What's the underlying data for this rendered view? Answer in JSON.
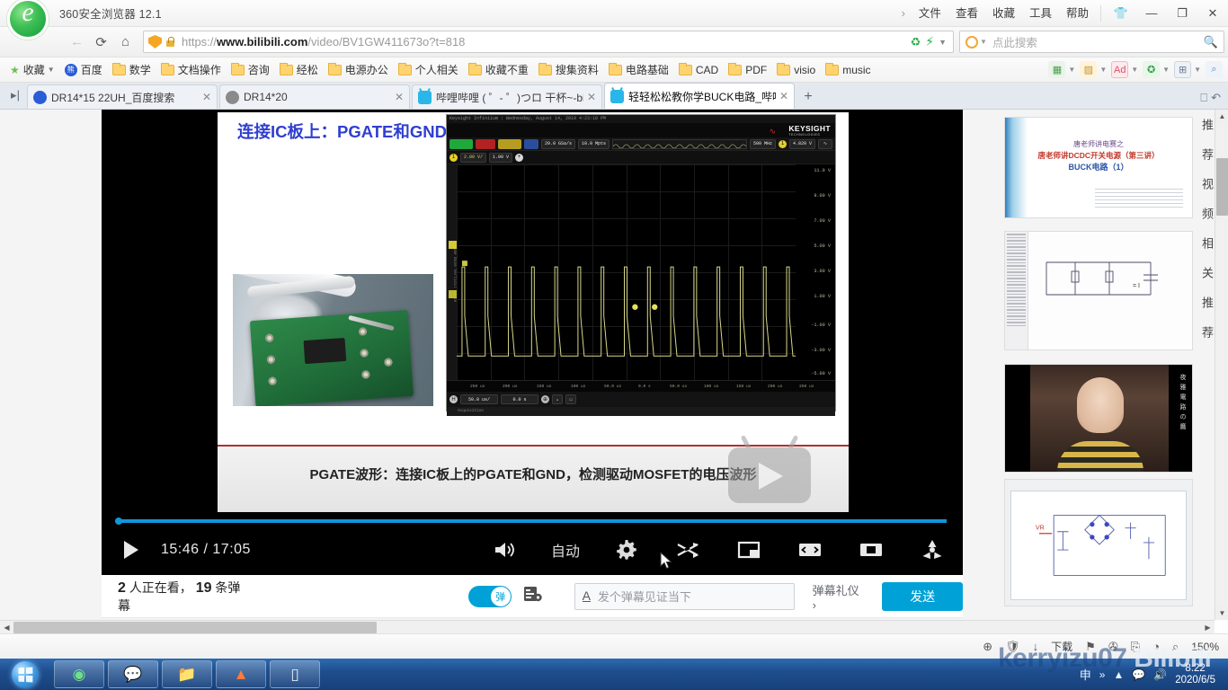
{
  "browser": {
    "app_name": "360安全浏览器 12.1",
    "menus": [
      "文件",
      "查看",
      "收藏",
      "工具",
      "帮助"
    ],
    "window_controls": {
      "minimize": "—",
      "maximize": "❐",
      "close": "✕",
      "skin": "👕",
      "chevron": "›"
    },
    "address": {
      "scheme": "https://",
      "domain": "www.bilibili.com",
      "path": "/video/BV1GW411673o?t=818",
      "full": "https://www.bilibili.com/video/BV1GW411673o?t=818"
    },
    "search": {
      "placeholder": "点此搜索"
    },
    "nav": {
      "back": "←",
      "reload": "⟳",
      "home": "⌂"
    },
    "bookmarks": [
      {
        "label": "收藏",
        "icon": "star-icon"
      },
      {
        "label": "百度",
        "icon": "baidu-icon"
      },
      {
        "label": "数学",
        "icon": "folder-icon"
      },
      {
        "label": "文档操作",
        "icon": "folder-icon"
      },
      {
        "label": "咨询",
        "icon": "folder-icon"
      },
      {
        "label": "经松",
        "icon": "folder-icon"
      },
      {
        "label": "电源办公",
        "icon": "folder-icon"
      },
      {
        "label": "个人相关",
        "icon": "folder-icon"
      },
      {
        "label": "收藏不重",
        "icon": "folder-icon"
      },
      {
        "label": "搜集资料",
        "icon": "folder-icon"
      },
      {
        "label": "电路基础",
        "icon": "folder-icon"
      },
      {
        "label": "CAD",
        "icon": "folder-icon"
      },
      {
        "label": "PDF",
        "icon": "folder-icon"
      },
      {
        "label": "visio",
        "icon": "folder-icon"
      },
      {
        "label": "music",
        "icon": "folder-icon"
      }
    ],
    "extensions": [
      "▦",
      "▨",
      "Ad",
      "✪",
      "⊞",
      "⌕"
    ],
    "tabs": [
      {
        "label": "DR14*15 22UH_百度搜索",
        "icon": "baidu-favicon",
        "active": false
      },
      {
        "label": "DR14*20",
        "icon": "globe-favicon",
        "active": false
      },
      {
        "label": "哔哩哔哩 ( ゜- ゜)つロ 干杯~-bi",
        "icon": "bilibili-favicon",
        "active": false
      },
      {
        "label": "轻轻松松教你学BUCK电路_哔哩",
        "icon": "bilibili-favicon",
        "active": true
      }
    ],
    "new_tab": "+"
  },
  "video": {
    "slide": {
      "title": "连接IC板上：PGATE和GND",
      "caption": "PGATE波形：连接IC板上的PGATE和GND，检测驱动MOSFET的电压波形"
    },
    "scope": {
      "header": "Keysight Infiniium : Wednesday, August 14, 2019 4:23:18 PM",
      "brand": "KEYSIGHT",
      "brand_sub": "TECHNOLOGIES",
      "sample_rate": "20.0 GSa/s",
      "memory": "10.0 Mpts",
      "bandwidth": "500 MHz",
      "trigger_level": "4.820 V",
      "channel_badge": "1",
      "vertical_scale": "2.00 V/",
      "offset": "1.00 V",
      "timebase": "50.0 us/",
      "delay": "0.0 s",
      "status": "Acquisition",
      "voltage_ticks": [
        "11.0 V",
        "9.00 V",
        "7.00 V",
        "5.00 V",
        "3.00 V",
        "1.00 V",
        "-1.00 V",
        "-3.00 V",
        "-5.00 V"
      ],
      "time_ticks": [
        "250 us",
        "200 us",
        "150 us",
        "100 us",
        "50.0 us",
        "0.0 s",
        "50.0 us",
        "100 us",
        "150 us",
        "200 us",
        "250 us"
      ],
      "corner_label": "-5.00 V",
      "left_tabs": "Time Base   Vertical Scale"
    },
    "controls": {
      "play": "play-icon",
      "current_time": "15:46",
      "separator": "/",
      "duration": "17:05",
      "volume": "volume-icon",
      "quality": "自动",
      "settings": "gear-icon",
      "shuffle": "shuffle-icon",
      "mini_player": "mini-player-icon",
      "wide_screen": "widescreen-icon",
      "fullscreen": "fullscreen-icon",
      "nuclear": "radiation-icon"
    },
    "progress_percent": 100
  },
  "danmaku": {
    "watching_count": "2",
    "watching_text": "人正在看，",
    "danmaku_count": "19",
    "danmaku_text": "条弹幕",
    "toggle_label": "弹",
    "settings_icon": "danmaku-settings-icon",
    "input_icon": "A",
    "input_placeholder": "发个弹幕见证当下",
    "etiquette": "弹幕礼仪 ›",
    "send_label": "发送"
  },
  "sidebar": {
    "vertical_text": "推荐视频相关推荐",
    "thumbnails": [
      {
        "name": "thumb-buck-title",
        "line1": "唐老师讲电赛之",
        "line2": "唐老师讲DCDC开关电源（第三讲）",
        "line3": "BUCK电路（1）"
      },
      {
        "name": "thumb-circuit-slide",
        "line1": "",
        "line2": "",
        "line3": ""
      },
      {
        "name": "thumb-person-video",
        "vertical": "夜雅電路の鷹"
      },
      {
        "name": "thumb-schematic-editor",
        "line1": "",
        "line2": "",
        "line3": ""
      }
    ],
    "scroll_up": "▲",
    "scroll_down": "▼"
  },
  "statusbar": {
    "icons": [
      "⊕",
      "🛡",
      "↓"
    ],
    "download_label": "下载",
    "more_icons": [
      "⚑",
      "✇",
      "⎘",
      "◑",
      "⌕"
    ],
    "zoom": "150%"
  },
  "taskbar": {
    "start": "start-orb",
    "apps": [
      "browser-icon",
      "qq-icon",
      "folder-icon",
      "app-icon",
      "window-icon"
    ],
    "tray": {
      "ime": "申",
      "chevron": "»",
      "caret": "▲",
      "qq": "qq-tray-icon",
      "volume": "volume-tray-icon"
    },
    "clock_time": "8:22",
    "clock_date": "2020/6/5"
  },
  "watermark": {
    "user": "kerryizu07",
    "site": "Bilibili"
  },
  "colors": {
    "bili_blue": "#00a1d6",
    "accent_title": "#2f3fd0",
    "caption_rule": "#b03030",
    "taskbar": "#1f4f8f"
  }
}
